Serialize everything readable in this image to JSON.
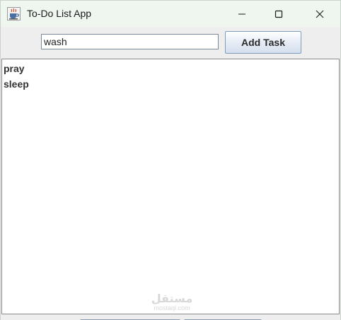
{
  "window": {
    "title": "To-Do List App",
    "icon": "java-cup-icon"
  },
  "titlebar_buttons": {
    "minimize": "minimize-icon",
    "maximize": "maximize-icon",
    "close": "close-icon"
  },
  "toolbar": {
    "task_input_value": "wash",
    "add_button_label": "Add Task"
  },
  "tasks": [
    {
      "label": "pray"
    },
    {
      "label": "sleep"
    }
  ],
  "watermark": {
    "arabic": "مستقل",
    "latin": "mostaql.com"
  }
}
